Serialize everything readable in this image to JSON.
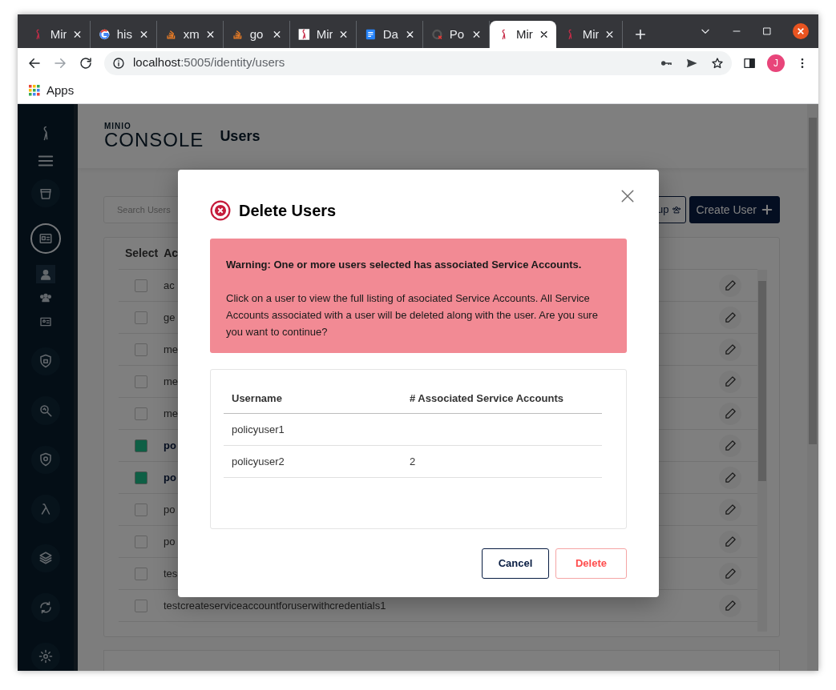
{
  "browser": {
    "tabs": [
      {
        "label": "Mir",
        "selected": false
      },
      {
        "label": "his",
        "selected": false
      },
      {
        "label": "xm",
        "selected": false
      },
      {
        "label": "go",
        "selected": false
      },
      {
        "label": "Mir",
        "selected": false
      },
      {
        "label": "Da",
        "selected": false
      },
      {
        "label": "Po",
        "selected": false
      },
      {
        "label": "Mir",
        "selected": true
      },
      {
        "label": "Mir",
        "selected": false
      }
    ],
    "address": {
      "host": "localhost",
      "path": ":5005/identity/users"
    },
    "profile": "J",
    "bookmarks": [
      "Apps"
    ]
  },
  "sidebar": {
    "items": [
      {
        "selected": false
      },
      {
        "selected": true,
        "children": [
          {
            "selected": true
          },
          {
            "selected": false
          },
          {
            "selected": false
          }
        ]
      },
      {
        "selected": false
      },
      {
        "selected": false
      },
      {
        "selected": false
      },
      {
        "selected": false
      },
      {
        "selected": false
      },
      {
        "selected": false
      },
      {
        "selected": false
      }
    ]
  },
  "header": {
    "brand_small": "MINIO",
    "brand": "CONSOLE",
    "title": "Users"
  },
  "toolbar": {
    "search": {
      "placeholder": "Search Users"
    },
    "buttons": [
      {
        "label": "up",
        "kind": "outline"
      },
      {
        "label": "Create User",
        "kind": "primary"
      }
    ]
  },
  "users_table": {
    "columns": [
      "Select",
      "Ac"
    ],
    "rows": [
      {
        "name": "ac",
        "checked": false
      },
      {
        "name": "ge",
        "checked": false
      },
      {
        "name": "me",
        "checked": false
      },
      {
        "name": "me",
        "checked": false
      },
      {
        "name": "me",
        "checked": false
      },
      {
        "name": "po",
        "checked": true
      },
      {
        "name": "po",
        "checked": true
      },
      {
        "name": "po",
        "checked": false
      },
      {
        "name": "po",
        "checked": false
      },
      {
        "name": "tes",
        "checked": false
      },
      {
        "name": "testcreateserviceaccountforuserwithcredentials1",
        "checked": false
      }
    ]
  },
  "dialog": {
    "title": "Delete Users",
    "warning": {
      "heading": "Warning: One or more users selected has associated Service Accounts.",
      "body": "Click on a user to view the full listing of asociated Service Accounts. All Service Accounts associated with a user will be deleted along with the user. Are you sure you want to continue?"
    },
    "table": {
      "columns": [
        "Username",
        "# Associated Service Accounts"
      ],
      "rows": [
        {
          "username": "policyuser1"
        },
        {
          "username": "policyuser2",
          "count": "2"
        }
      ]
    },
    "buttons": [
      {
        "label": "Cancel",
        "kind": "cancel"
      },
      {
        "label": "Delete",
        "kind": "delete"
      }
    ]
  }
}
